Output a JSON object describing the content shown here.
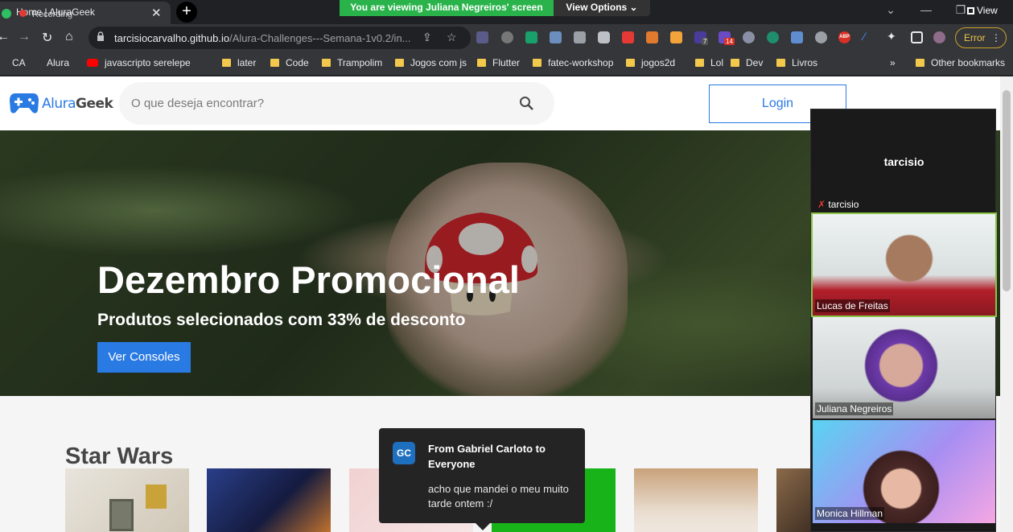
{
  "browser": {
    "tab_title": "Home | AluraGeek",
    "recording_label": "Recording",
    "tab_close": "✕",
    "new_tab": "+",
    "share_banner": "You are viewing Juliana Negreiros' screen",
    "view_options": "View Options ⌄",
    "view_label": "View",
    "url_host": "tarcisiocarvalho.github.io",
    "url_path": "/Alura-Challenges---Semana-1v0.2/in...",
    "error_label": "Error",
    "ext_badge_7": "7",
    "ext_badge_14": "14",
    "abp": "ABP"
  },
  "bookmarks": {
    "items": [
      "CA",
      "Alura",
      "javascripto serelepe",
      "later",
      "Code",
      "Trampolim",
      "Jogos com js",
      "Flutter",
      "fatec-workshop",
      "jogos2d",
      "Lol",
      "Dev",
      "Livros"
    ],
    "overflow": "»",
    "other": "Other bookmarks"
  },
  "site": {
    "logo_a": "Alura",
    "logo_b": "Geek",
    "search_placeholder": "O que deseja encontrar?",
    "login": "Login",
    "hero_title": "Dezembro Promocional",
    "hero_subtitle": "Produtos selecionados com 33% de desconto",
    "hero_button": "Ver Consoles",
    "section_title": "Star Wars"
  },
  "meeting": {
    "host_name": "tarcisio",
    "host_label": "tarcisio",
    "participants": [
      "Lucas de Freitas",
      "Juliana Negreiros",
      "Monica Hillman"
    ]
  },
  "chat": {
    "initials": "GC",
    "from": "From Gabriel Carloto to Everyone",
    "message": "acho que mandei o meu muito tarde ontem :/"
  },
  "colors": {
    "brand_blue": "#2a7ae4",
    "share_green": "#29b34a",
    "active_speaker": "#8bc34a"
  }
}
